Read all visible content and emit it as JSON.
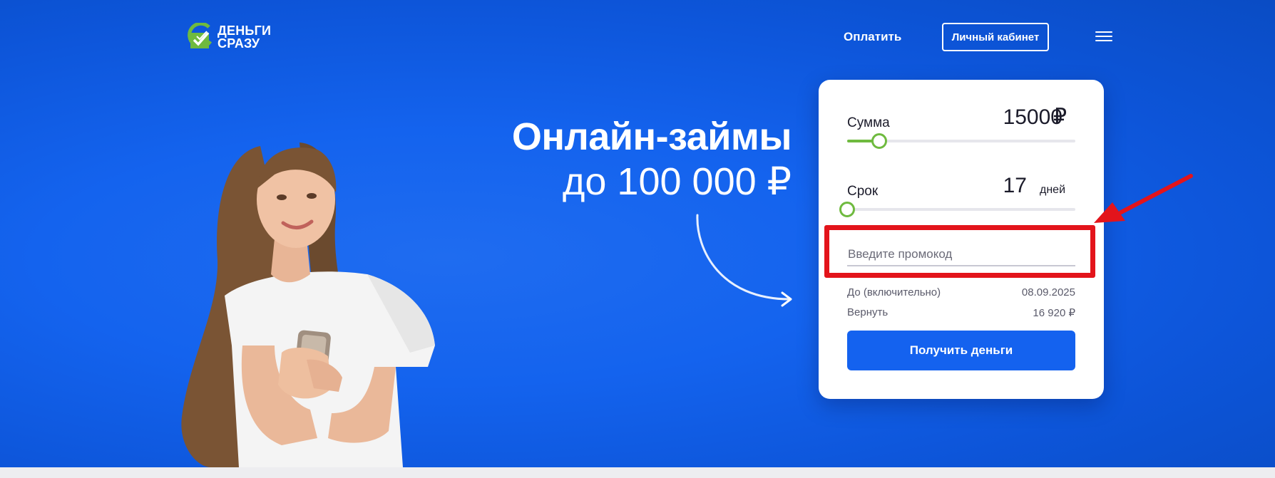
{
  "header": {
    "logo_line1": "ДЕНЬГИ",
    "logo_line2": "СРАЗУ",
    "nav_pay": "Оплатить",
    "cabinet_button": "Личный кабинет"
  },
  "hero": {
    "title": "Онлайн-займы",
    "subtitle": "до 100 000 ₽"
  },
  "calculator": {
    "amount_label": "Сумма",
    "amount_value": "15000",
    "amount_unit": "₽",
    "amount_slider_fraction": 0.14,
    "term_label": "Срок",
    "term_value": "17",
    "term_unit": "дней",
    "term_slider_fraction": 0.0,
    "promo_placeholder": "Введите промокод",
    "due_label": "До (включительно)",
    "due_value": "08.09.2025",
    "return_label": "Вернуть",
    "return_value": "16 920 ₽",
    "submit_button": "Получить деньги"
  },
  "colors": {
    "background_blue": "#1463ee",
    "accent_green": "#6fba3f",
    "button_blue": "#1462ef",
    "highlight_red": "#e3141b"
  }
}
